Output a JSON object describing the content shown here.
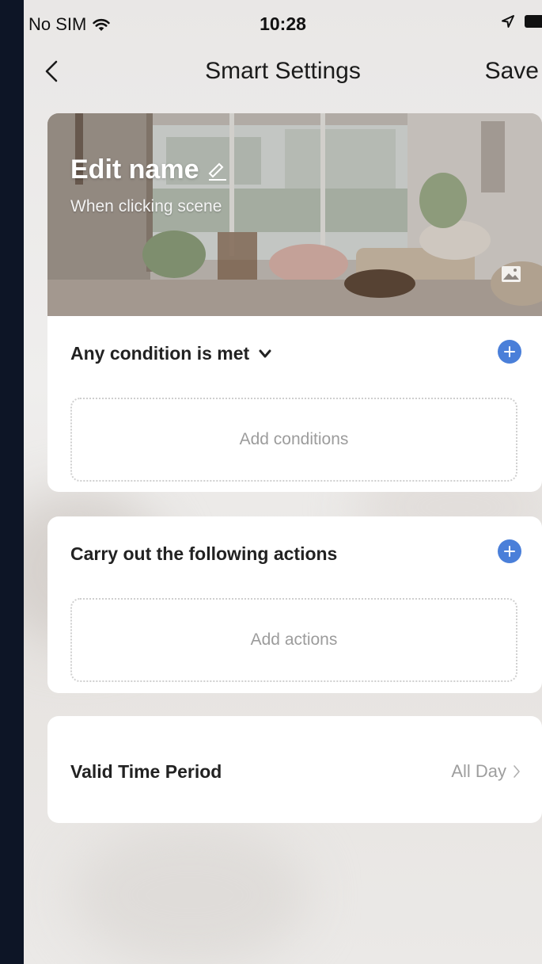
{
  "status_bar": {
    "carrier": "No SIM",
    "time": "10:28"
  },
  "nav": {
    "title": "Smart Settings",
    "save_label": "Save"
  },
  "scene": {
    "name": "Edit name",
    "subtitle": "When clicking  scene"
  },
  "conditions": {
    "title": "Any condition is met",
    "placeholder": "Add conditions"
  },
  "actions": {
    "title": "Carry out the following actions",
    "placeholder": "Add actions"
  },
  "valid_time": {
    "label": "Valid Time Period",
    "value": "All Day"
  },
  "colors": {
    "accent": "#4a7fd9",
    "background": "#0d1526"
  }
}
